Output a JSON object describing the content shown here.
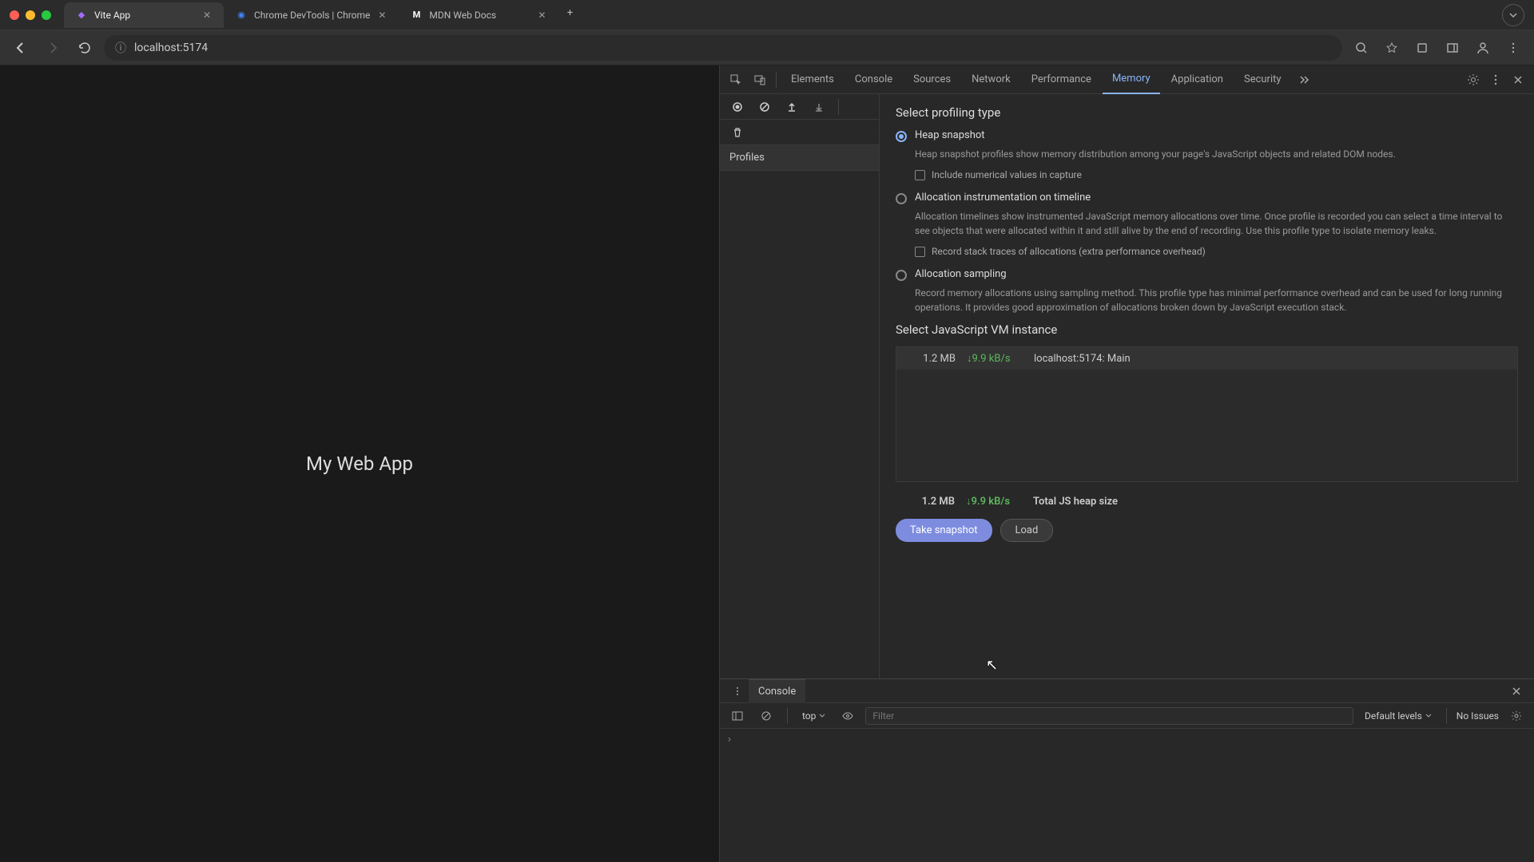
{
  "browser_tabs": [
    {
      "title": "Vite App",
      "favicon": "⚡",
      "active": true
    },
    {
      "title": "Chrome DevTools  |  Chrome",
      "favicon": "◉",
      "active": false
    },
    {
      "title": "MDN Web Docs",
      "favicon": "M",
      "active": false
    }
  ],
  "url": "localhost:5174",
  "page_content": "My Web App",
  "devtools": {
    "tabs": [
      "Elements",
      "Console",
      "Sources",
      "Network",
      "Performance",
      "Memory",
      "Application",
      "Security"
    ],
    "active_tab": "Memory",
    "sidebar": {
      "profiles_label": "Profiles"
    },
    "profiling": {
      "section_title": "Select profiling type",
      "options": [
        {
          "id": "heap",
          "label": "Heap snapshot",
          "desc": "Heap snapshot profiles show memory distribution among your page's JavaScript objects and related DOM nodes.",
          "checked": true,
          "sub_checkbox": "Include numerical values in capture"
        },
        {
          "id": "timeline",
          "label": "Allocation instrumentation on timeline",
          "desc": "Allocation timelines show instrumented JavaScript memory allocations over time. Once profile is recorded you can select a time interval to see objects that were allocated within it and still alive by the end of recording. Use this profile type to isolate memory leaks.",
          "checked": false,
          "sub_checkbox": "Record stack traces of allocations (extra performance overhead)"
        },
        {
          "id": "sampling",
          "label": "Allocation sampling",
          "desc": "Record memory allocations using sampling method. This profile type has minimal performance overhead and can be used for long running operations. It provides good approximation of allocations broken down by JavaScript execution stack.",
          "checked": false
        }
      ]
    },
    "vm": {
      "section_title": "Select JavaScript VM instance",
      "rows": [
        {
          "size": "1.2 MB",
          "rate": "↓9.9 kB/s",
          "name": "localhost:5174: Main"
        }
      ],
      "total": {
        "size": "1.2 MB",
        "rate": "↓9.9 kB/s",
        "label": "Total JS heap size"
      }
    },
    "actions": {
      "take_snapshot": "Take snapshot",
      "load": "Load"
    }
  },
  "console": {
    "tab_label": "Console",
    "context": "top",
    "filter_placeholder": "Filter",
    "levels": "Default levels",
    "issues": "No Issues",
    "prompt": "›"
  }
}
